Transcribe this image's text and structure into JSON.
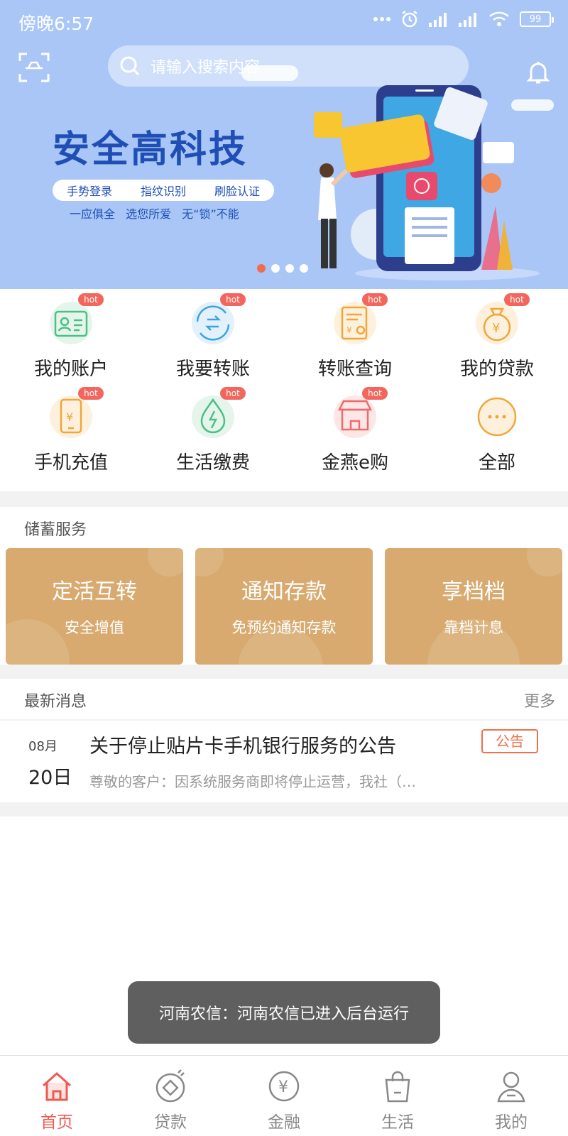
{
  "status_bar": {
    "time": "傍晚6:57",
    "battery": "99"
  },
  "search": {
    "placeholder": "请输入搜索内容"
  },
  "banner": {
    "headline": "安全高科技",
    "features": [
      "手势登录",
      "指纹识别",
      "刷脸认证"
    ],
    "tagline": "一应俱全 选您所爱 无“锁”不能",
    "slide_count": 4,
    "active_slide": 1
  },
  "quick_grid": {
    "hot_label": "hot",
    "items": [
      {
        "label": "我的账户",
        "icon": "account-card-icon",
        "hot": true
      },
      {
        "label": "我要转账",
        "icon": "transfer-icon",
        "hot": true
      },
      {
        "label": "转账查询",
        "icon": "transfer-query-icon",
        "hot": true
      },
      {
        "label": "我的贷款",
        "icon": "loan-bag-icon",
        "hot": true
      },
      {
        "label": "手机充值",
        "icon": "phone-topup-icon",
        "hot": true
      },
      {
        "label": "生活缴费",
        "icon": "utility-drop-icon",
        "hot": true
      },
      {
        "label": "金燕e购",
        "icon": "shop-icon",
        "hot": true
      },
      {
        "label": "全部",
        "icon": "more-dots-icon",
        "hot": false
      }
    ]
  },
  "savings": {
    "title": "储蓄服务",
    "cards": [
      {
        "title": "定活互转",
        "subtitle": "安全增值"
      },
      {
        "title": "通知存款",
        "subtitle": "免预约通知存款"
      },
      {
        "title": "享档档",
        "subtitle": "靠档计息"
      }
    ]
  },
  "news": {
    "title": "最新消息",
    "more": "更多",
    "items": [
      {
        "month": "08月",
        "day": "20日",
        "headline": "关于停止贴片卡手机银行服务的公告",
        "snippet": "尊敬的客户：因系统服务商即将停止运营，我社（…",
        "tag": "公告"
      }
    ]
  },
  "toast": {
    "text": "河南农信：河南农信已进入后台运行"
  },
  "tabbar": {
    "active": 0,
    "items": [
      {
        "label": "首页",
        "icon": "home-icon"
      },
      {
        "label": "贷款",
        "icon": "loan-icon"
      },
      {
        "label": "金融",
        "icon": "finance-yen-icon"
      },
      {
        "label": "生活",
        "icon": "shopping-bag-icon"
      },
      {
        "label": "我的",
        "icon": "profile-icon"
      }
    ]
  },
  "colors": {
    "banner_bg": "#a9c6f7",
    "headline": "#1f4fb5",
    "hot_badge": "#f2665e",
    "savings_card": "#d8aa6f",
    "accent_red": "#ef5a50",
    "tag_orange": "#f0704a"
  }
}
